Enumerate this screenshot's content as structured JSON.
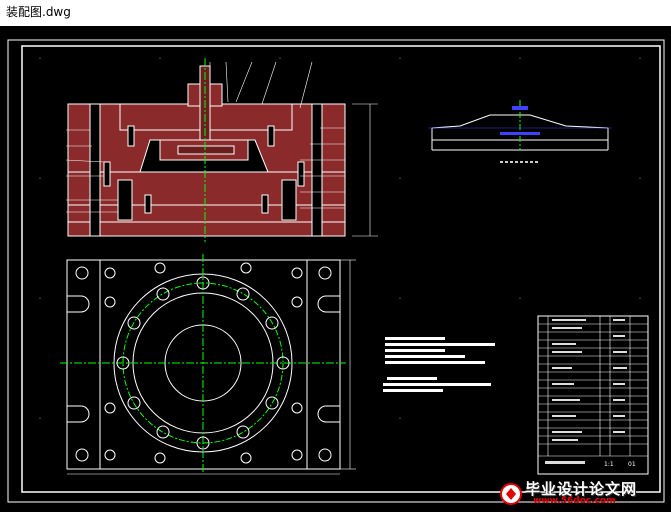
{
  "window": {
    "title": "装配图.dwg"
  },
  "drawing": {
    "background": "#000000",
    "border_color": "#ffffff",
    "section_fill": "#8b2a2a",
    "centerline_color": "#00ff00",
    "title_block": {
      "scale": "1:1",
      "sheet": "01"
    }
  },
  "watermark": {
    "title": "毕业设计论文网",
    "url": "www.56doc.com"
  }
}
